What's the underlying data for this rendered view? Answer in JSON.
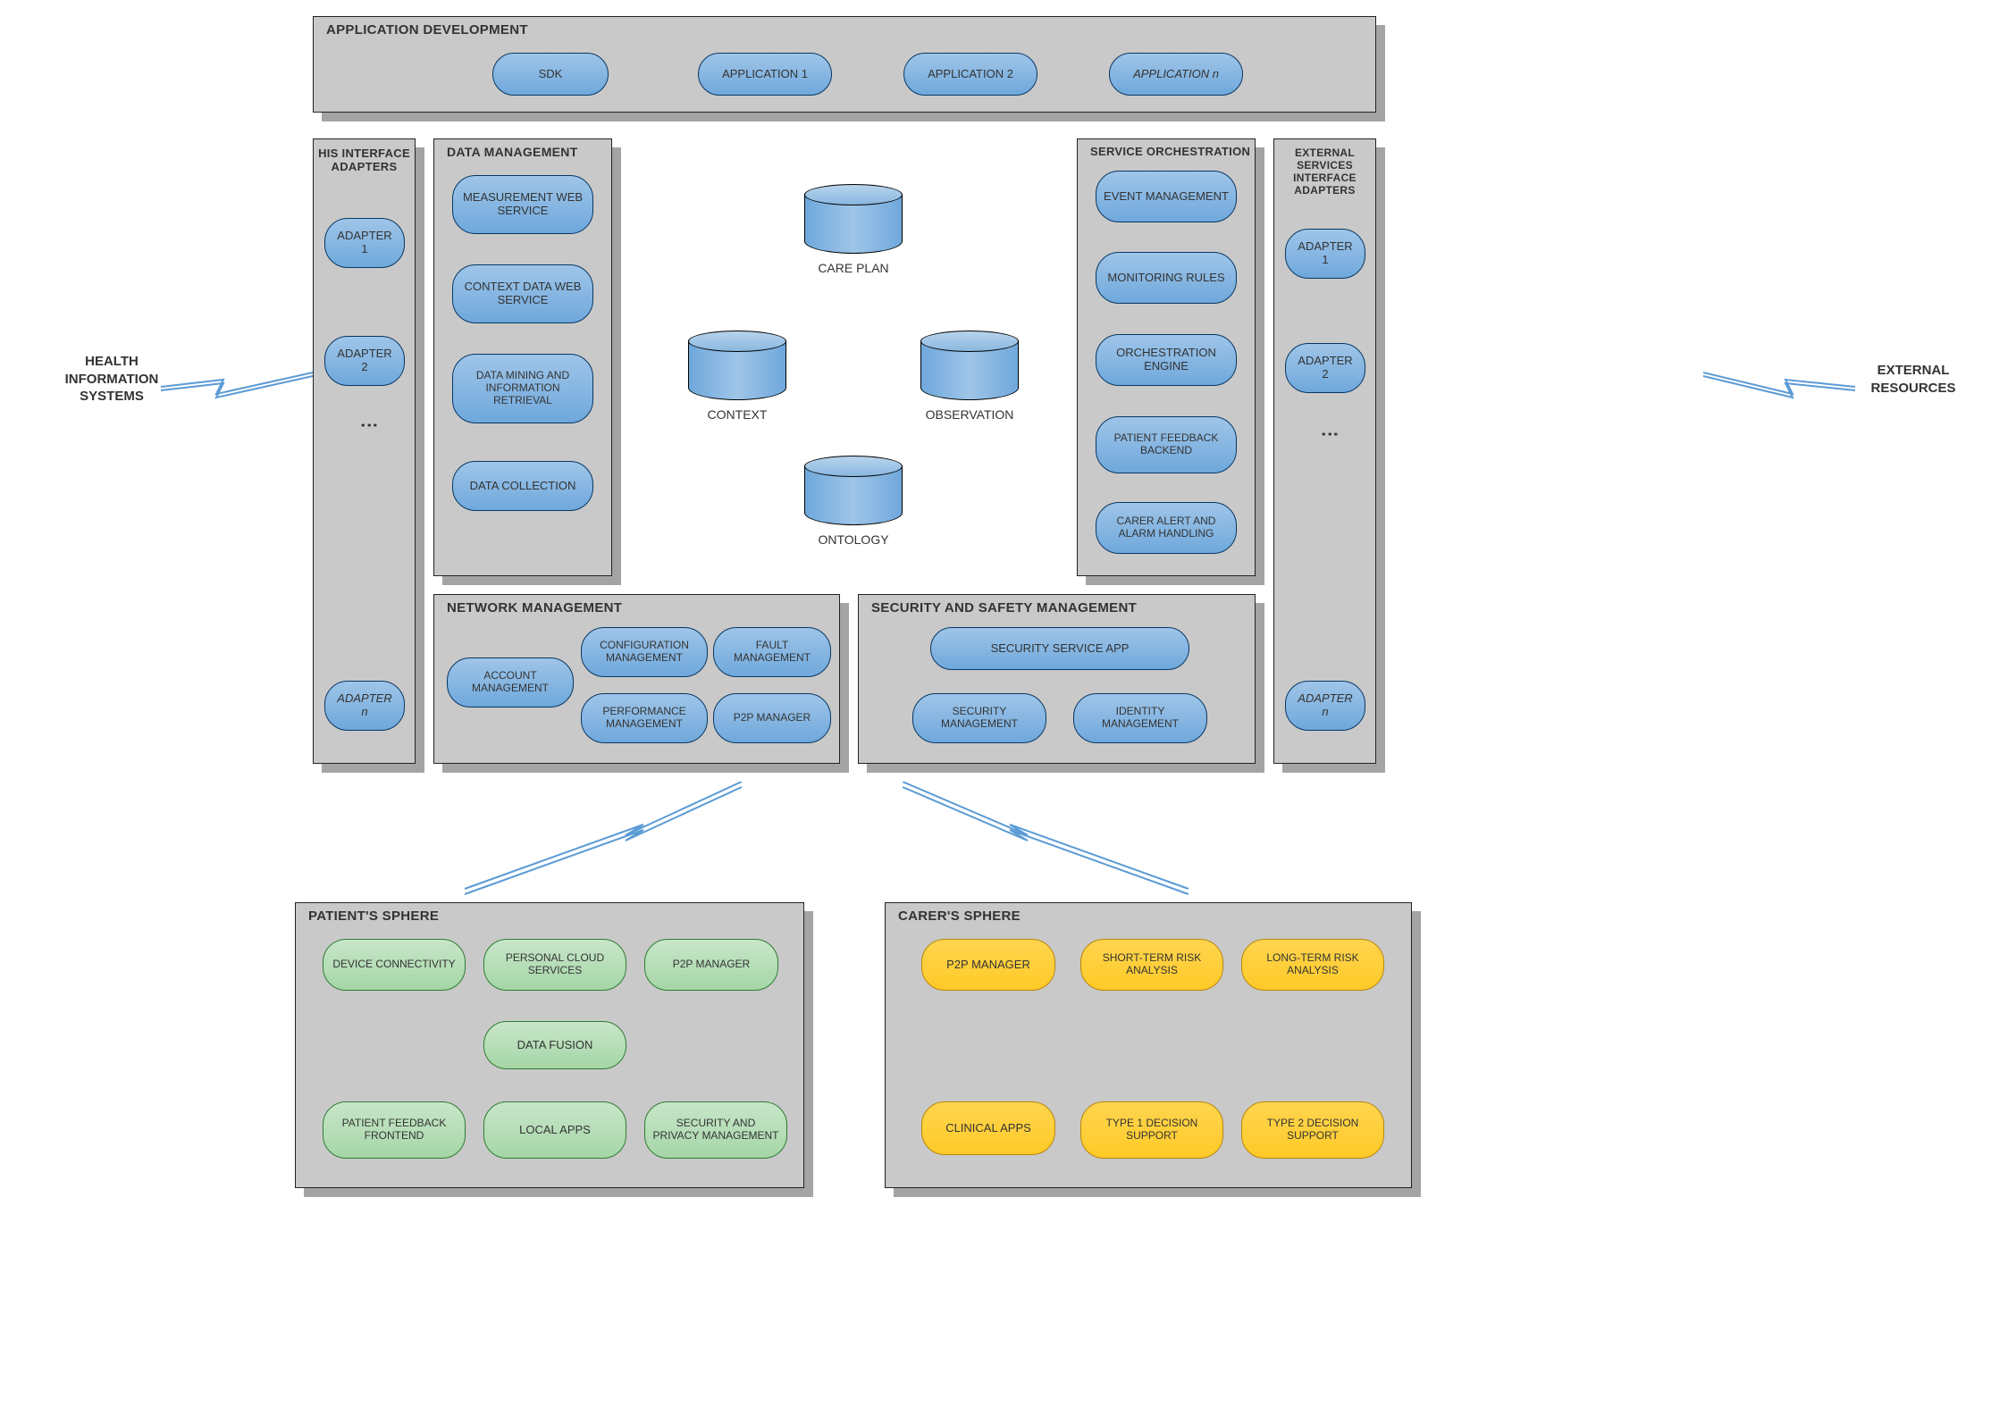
{
  "external": {
    "left_label": "HEALTH INFORMATION SYSTEMS",
    "right_label": "EXTERNAL RESOURCES"
  },
  "app_dev": {
    "title": "APPLICATION DEVELOPMENT",
    "items": [
      "SDK",
      "APPLICATION 1",
      "APPLICATION 2",
      "APPLICATION n"
    ]
  },
  "his_adapters": {
    "title": "HIS INTERFACE ADAPTERS",
    "items": [
      "ADAPTER 1",
      "ADAPTER 2",
      "ADAPTER n"
    ]
  },
  "ext_adapters": {
    "title": "EXTERNAL SERVICES INTERFACE ADAPTERS",
    "items": [
      "ADAPTER 1",
      "ADAPTER 2",
      "ADAPTER n"
    ]
  },
  "data_mgmt": {
    "title": "DATA MANAGEMENT",
    "items": [
      "MEASUREMENT WEB SERVICE",
      "CONTEXT DATA WEB SERVICE",
      "DATA MINING AND INFORMATION RETRIEVAL",
      "DATA COLLECTION"
    ]
  },
  "service_orch": {
    "title": "SERVICE ORCHESTRATION",
    "items": [
      "EVENT MANAGEMENT",
      "MONITORING RULES",
      "ORCHESTRATION ENGINE",
      "PATIENT FEEDBACK BACKEND",
      "CARER ALERT AND ALARM HANDLING"
    ]
  },
  "cylinders": {
    "care_plan": "CARE PLAN",
    "context": "CONTEXT",
    "observation": "OBSERVATION",
    "ontology": "ONTOLOGY"
  },
  "network_mgmt": {
    "title": "NETWORK MANAGEMENT",
    "items": [
      "ACCOUNT MANAGEMENT",
      "CONFIGURATION MANAGEMENT",
      "FAULT MANAGEMENT",
      "PERFORMANCE MANAGEMENT",
      "P2P MANAGER"
    ]
  },
  "security_mgmt": {
    "title": "SECURITY AND SAFETY MANAGEMENT",
    "items": [
      "SECURITY SERVICE APP",
      "SECURITY MANAGEMENT",
      "IDENTITY MANAGEMENT"
    ]
  },
  "patient_sphere": {
    "title": "PATIENT'S SPHERE",
    "items": [
      "DEVICE CONNECTIVITY",
      "PERSONAL CLOUD SERVICES",
      "P2P MANAGER",
      "DATA FUSION",
      "PATIENT FEEDBACK FRONTEND",
      "LOCAL APPS",
      "SECURITY AND PRIVACY MANAGEMENT"
    ]
  },
  "carer_sphere": {
    "title": "CARER'S SPHERE",
    "items": [
      "P2P MANAGER",
      "SHORT-TERM RISK ANALYSIS",
      "LONG-TERM RISK ANALYSIS",
      "CLINICAL APPS",
      "TYPE 1 DECISION SUPPORT",
      "TYPE 2 DECISION SUPPORT"
    ]
  }
}
